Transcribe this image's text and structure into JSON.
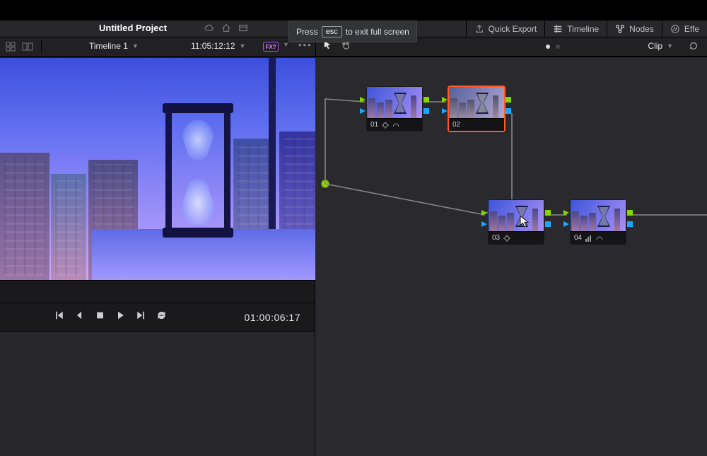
{
  "titlebar": {
    "project_title": "Untitled Project"
  },
  "esc_overlay": {
    "press": "Press",
    "key": "esc",
    "rest": "to exit full screen"
  },
  "top_menu": {
    "quick_export": "Quick Export",
    "timeline": "Timeline",
    "nodes": "Nodes",
    "effects": "Effe"
  },
  "toolbar": {
    "timeline_name": "Timeline 1",
    "timeline_tc": "11:05:12:12",
    "badge": "FX?",
    "clip_label": "Clip"
  },
  "viewer": {
    "player_tc": "01:00:06:17"
  },
  "nodes": {
    "n01": {
      "label": "01"
    },
    "n02": {
      "label": "02"
    },
    "n03": {
      "label": "03"
    },
    "n04": {
      "label": "04"
    }
  },
  "icons": {
    "cloud": "cloud-icon",
    "home": "home-icon",
    "workspace": "workspace-icon",
    "export": "export-icon",
    "timeline": "timeline-icon",
    "nodes": "nodes-icon",
    "fx": "fx-icon",
    "grid": "layout-grid-icon",
    "dual": "dual-view-icon",
    "arrow_tool": "arrow-tool-icon",
    "hand_tool": "hand-tool-icon",
    "reset": "reset-icon",
    "prev_clip": "skip-back-icon",
    "step_back": "frame-back-icon",
    "stop": "stop-icon",
    "play": "play-icon",
    "step_fwd": "frame-forward-icon",
    "next_clip": "skip-forward-icon",
    "loop": "loop-icon",
    "crosshair": "crosshair-icon",
    "hdr": "hdr-icon",
    "bars": "bars-icon"
  }
}
